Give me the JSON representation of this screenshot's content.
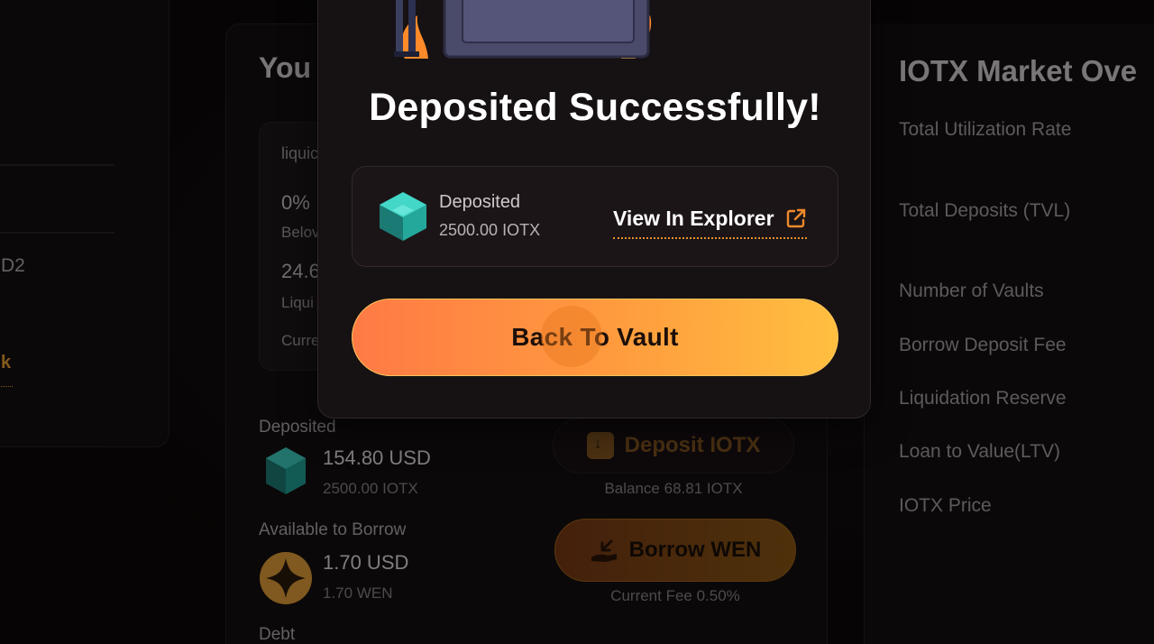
{
  "modal": {
    "title": "Deposited Successfully!",
    "info_label": "Deposited",
    "info_amount": "2500.00 IOTX",
    "explorer_link": "View In Explorer",
    "back_button": "Back To Vault"
  },
  "left_panel": {
    "fragment_d2": "D2",
    "fragment_k": "k"
  },
  "vault": {
    "title": "You",
    "card": {
      "liquid": "liquic",
      "zero_pct": "0%",
      "below": "Belov",
      "value": "24.6",
      "liqui": "Liqui",
      "curr": "Curre"
    },
    "deposited": {
      "label": "Deposited",
      "usd": "154.80 USD",
      "amount": "2500.00 IOTX"
    },
    "available": {
      "label": "Available to Borrow",
      "usd": "1.70 USD",
      "amount": "1.70 WEN"
    },
    "debt_label": "Debt",
    "deposit_button": "Deposit IOTX",
    "balance": "Balance 68.81 IOTX",
    "borrow_button": "Borrow WEN",
    "current_fee": "Current Fee 0.50%"
  },
  "market": {
    "title": "IOTX Market Ove",
    "rows": [
      "Total Utilization Rate",
      "Total Deposits (TVL)",
      "Number of Vaults",
      "Borrow Deposit Fee",
      "Liquidation Reserve",
      "Loan to Value(LTV)",
      "IOTX Price"
    ]
  },
  "colors": {
    "accent_orange": "#ff8a3d",
    "accent_yellow": "#ffbf40",
    "link_underline": "#e7912e",
    "iotx_teal": "#2ec4b6"
  }
}
